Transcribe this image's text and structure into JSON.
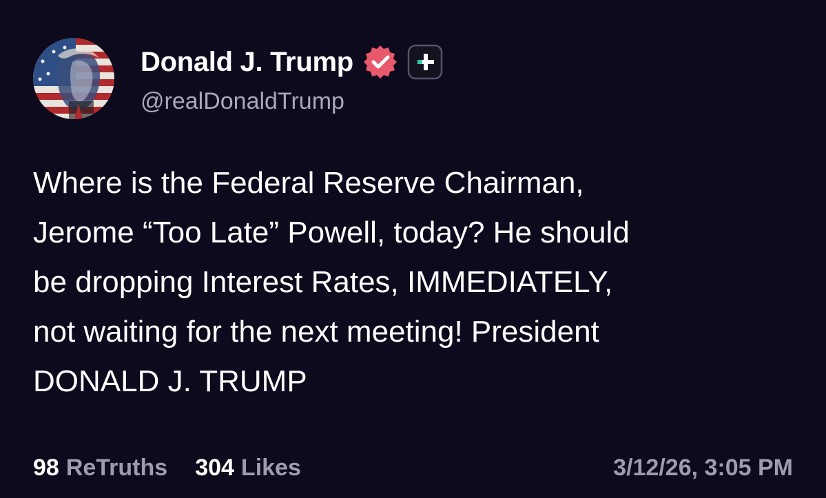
{
  "author": {
    "display_name": "Donald J. Trump",
    "handle": "@realDonaldTrump",
    "avatar_icon": "avatar-flag-portrait",
    "verified_icon": "verified-badge-icon",
    "plus_icon": "plus-badge-icon"
  },
  "post": {
    "lines": [
      "Where is the Federal Reserve Chairman,",
      "Jerome “Too Late” Powell, today? He should",
      "be dropping Interest Rates, IMMEDIATELY,",
      "not waiting for the next meeting! President",
      "DONALD J. TRUMP"
    ]
  },
  "stats": {
    "retruths_count": "98",
    "retruths_label": "ReTruths",
    "likes_count": "304",
    "likes_label": "Likes"
  },
  "timestamp": "3/12/26, 3:05 PM",
  "colors": {
    "background": "#0c0a1c",
    "verified_badge": "#e8596b",
    "plus_accent": "#2fc9a8",
    "muted_text": "#9d9bac"
  }
}
